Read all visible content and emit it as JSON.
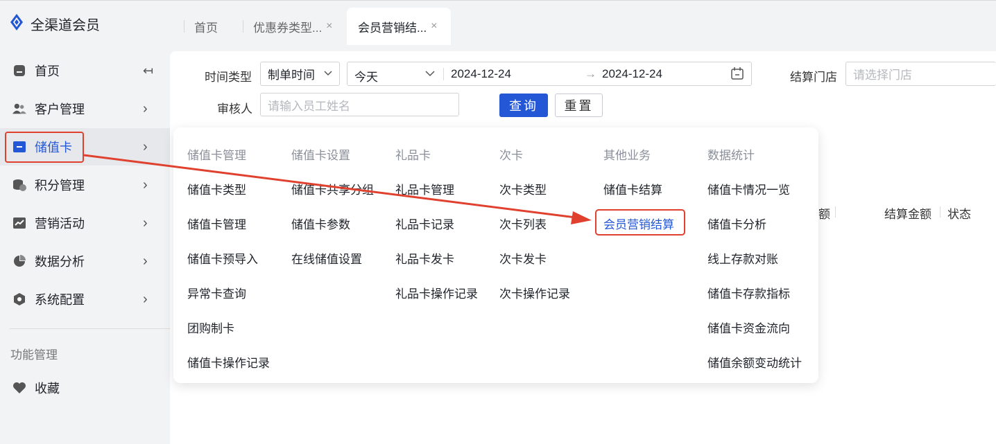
{
  "app": {
    "title": "全渠道会员"
  },
  "tabs": [
    {
      "label": "首页",
      "closable": false
    },
    {
      "label": "优惠券类型...",
      "closable": true
    },
    {
      "label": "会员营销结...",
      "closable": true,
      "active": true
    }
  ],
  "tab_close_glyph": "×",
  "sidebar": {
    "collapse_glyph": "↤",
    "chevron_glyph": "›",
    "items": [
      {
        "label": "首页",
        "icon": "home-icon"
      },
      {
        "label": "客户管理",
        "icon": "users-icon"
      },
      {
        "label": "储值卡",
        "icon": "card-icon",
        "active": true
      },
      {
        "label": "积分管理",
        "icon": "coins-icon"
      },
      {
        "label": "营销活动",
        "icon": "chart-icon"
      },
      {
        "label": "数据分析",
        "icon": "pie-icon"
      },
      {
        "label": "系统配置",
        "icon": "settings-icon"
      }
    ],
    "section_title": "功能管理",
    "favorites": {
      "label": "收藏",
      "icon": "heart-icon"
    }
  },
  "filters": {
    "time_type_label": "时间类型",
    "time_type_value": "制单时间",
    "date_range_preset": "今天",
    "date_start": "2024-12-24",
    "date_arrow": "→",
    "date_end": "2024-12-24",
    "store_label": "结算门店",
    "store_placeholder": "请选择门店",
    "reviewer_label": "审核人",
    "reviewer_placeholder": "请输入员工姓名",
    "query_button": "查询",
    "reset_button": "重置"
  },
  "table": {
    "headers": [
      "额",
      "结算金额",
      "状态"
    ]
  },
  "mega_menu": {
    "columns": [
      {
        "title": "储值卡管理",
        "items": [
          "储值卡类型",
          "储值卡管理",
          "储值卡预导入",
          "异常卡查询",
          "团购制卡",
          "储值卡操作记录"
        ]
      },
      {
        "title": "储值卡设置",
        "items": [
          "储值卡共享分组",
          "储值卡参数",
          "在线储值设置"
        ]
      },
      {
        "title": "礼品卡",
        "items": [
          "礼品卡管理",
          "礼品卡记录",
          "礼品卡发卡",
          "礼品卡操作记录"
        ]
      },
      {
        "title": "次卡",
        "items": [
          "次卡类型",
          "次卡列表",
          "次卡发卡",
          "次卡操作记录"
        ]
      },
      {
        "title": "其他业务",
        "items": [
          "储值卡结算",
          "会员营销结算"
        ]
      },
      {
        "title": "数据统计",
        "items": [
          "储值卡情况一览",
          "储值卡分析",
          "线上存款对账",
          "储值卡存款指标",
          "储值卡资金流向",
          "储值余额变动统计"
        ]
      }
    ],
    "selected_item": "会员营销结算"
  },
  "colors": {
    "accent": "#2457d6",
    "annotation": "#e0412e"
  }
}
